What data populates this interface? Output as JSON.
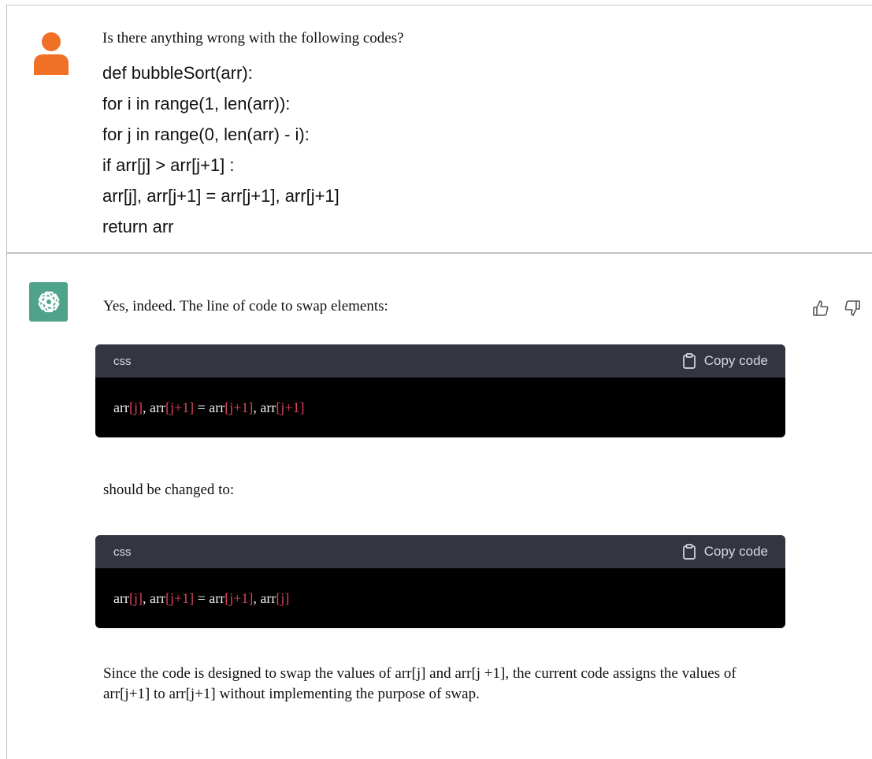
{
  "user_message": {
    "question": "Is there anything wrong with the following codes?",
    "code_lines": [
      "def bubbleSort(arr):",
      "for i in range(1, len(arr)):",
      "for j in range(0, len(arr) - i):",
      "if arr[j] > arr[j+1] :",
      "arr[j], arr[j+1] = arr[j+1], arr[j+1]",
      "return arr"
    ]
  },
  "assistant_message": {
    "intro": "Yes, indeed. The line of code to swap elements:",
    "code_block_1": {
      "language": "css",
      "copy_label": "Copy code",
      "tokens": [
        "arr",
        "[j]",
        ", ",
        "arr",
        "[j+1]",
        " = ",
        "arr",
        "[j+1]",
        ", ",
        "arr",
        "[j+1]"
      ]
    },
    "middle": "should be changed to:",
    "code_block_2": {
      "language": "css",
      "copy_label": "Copy code",
      "tokens": [
        "arr",
        "[j]",
        ", ",
        "arr",
        "[j+1]",
        " = ",
        "arr",
        "[j+1]",
        ", ",
        "arr",
        "[j]"
      ]
    },
    "conclusion": "Since the code is designed to swap the values of arr[j] and arr[j +1], the current code assigns the values of arr[j+1] to arr[j+1] without implementing the purpose of swap."
  },
  "icons": {
    "user_avatar": "user-avatar-icon",
    "assistant_avatar": "openai-logo-icon",
    "thumbs_up": "thumbs-up-icon",
    "thumbs_down": "thumbs-down-icon",
    "copy": "clipboard-icon"
  },
  "colors": {
    "user_avatar": "#f07025",
    "assistant_avatar_bg": "#4fa38a",
    "code_header_bg": "#343541",
    "code_body_bg": "#000000",
    "code_bracket": "#d9425d"
  }
}
